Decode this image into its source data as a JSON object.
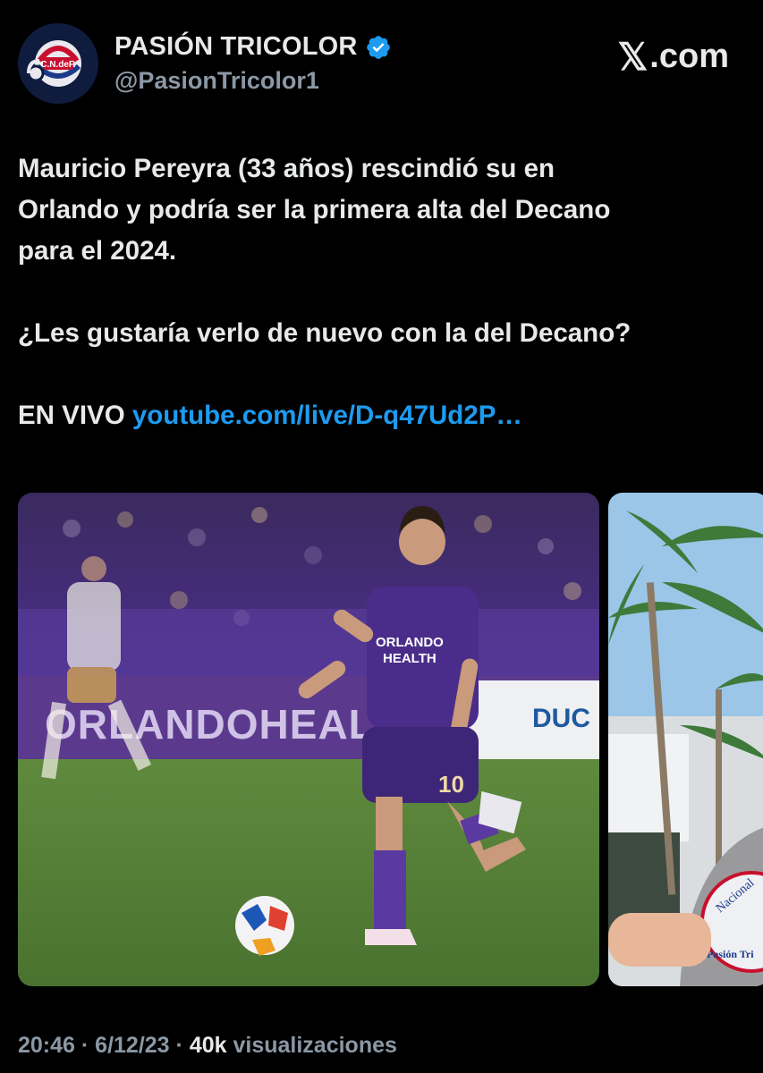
{
  "author": {
    "display_name": "PASIÓN TRICOLOR",
    "handle": "@PasionTricolor1",
    "avatar_text": "C.N.deF.",
    "verified": true
  },
  "brand": {
    "x_glyph": "𝕏",
    "domain": ".com"
  },
  "tweet": {
    "line1": "Mauricio Pereyra (33 años) rescindió su en",
    "line2": "Orlando y podría ser la primera alta del Decano",
    "line3": "para el 2024.",
    "line4": "¿Les gustaría verlo de nuevo con la del Decano?",
    "live_label": "EN VIVO",
    "link_text": "youtube.com/live/D-q47Ud2P…"
  },
  "media": {
    "photo1": {
      "board_text": "ORLANDOHEALTH",
      "board_right_text": "DUC",
      "jersey_text_1": "ORLANDO",
      "jersey_text_2": "HEALTH",
      "jersey_number": "10"
    },
    "photo2": {
      "badge_text_1": "Nacional",
      "badge_text_2": "Pasión Tri"
    }
  },
  "meta": {
    "time": "20:46",
    "sep1": " · ",
    "date": "6/12/23",
    "sep2": " · ",
    "views_count": "40k",
    "views_label": " visualizaciones"
  },
  "colors": {
    "background": "#000000",
    "text": "#e7e9ea",
    "secondary": "#8b98a5",
    "link": "#1d9bf0",
    "verified": "#1d9bf0"
  }
}
